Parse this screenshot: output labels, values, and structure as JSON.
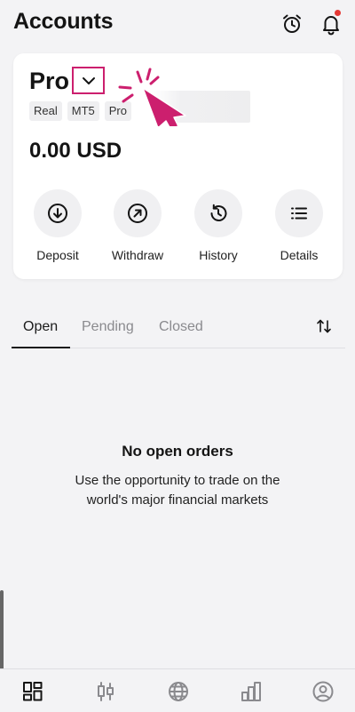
{
  "header": {
    "title": "Accounts",
    "icons": [
      "alarm-clock-icon",
      "bell-icon"
    ],
    "notification_dot_color": "#e53935"
  },
  "account": {
    "name": "Pro",
    "tags": [
      "Real",
      "MT5",
      "Pro"
    ],
    "balance": "0.00 USD",
    "highlight_color": "#cc1f6e"
  },
  "actions": [
    {
      "label": "Deposit",
      "icon": "arrow-down-circle-icon"
    },
    {
      "label": "Withdraw",
      "icon": "arrow-up-right-circle-icon"
    },
    {
      "label": "History",
      "icon": "history-icon"
    },
    {
      "label": "Details",
      "icon": "list-icon"
    }
  ],
  "tabs": [
    {
      "label": "Open",
      "active": true
    },
    {
      "label": "Pending",
      "active": false
    },
    {
      "label": "Closed",
      "active": false
    }
  ],
  "empty_state": {
    "title": "No open orders",
    "line1": "Use the opportunity to trade on the",
    "line2": "world's major financial markets"
  },
  "bottom_nav": [
    "accounts-icon",
    "trade-icon",
    "markets-icon",
    "performance-icon",
    "profile-icon"
  ]
}
